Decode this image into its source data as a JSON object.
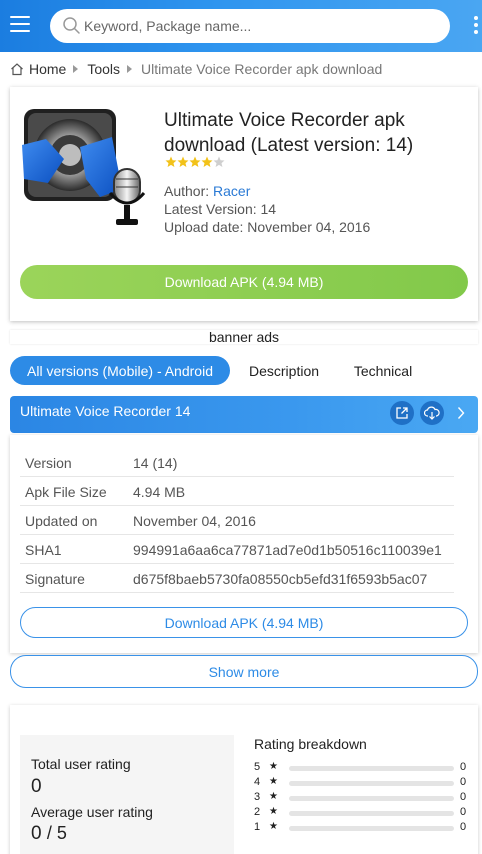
{
  "header": {
    "search_placeholder": "Keyword, Package name...",
    "icons": {
      "menu": "hamburger-menu-icon",
      "search": "search-icon",
      "more": "vertical-dots-icon"
    }
  },
  "breadcrumb": {
    "items": [
      "Home",
      "Tools",
      "Ultimate Voice Recorder apk download"
    ]
  },
  "app": {
    "title": "Ultimate Voice Recorder apk download (Latest version: 14)",
    "rating_stars": 4,
    "rating_max": 5,
    "author_label": "Author: ",
    "author_name": "Racer",
    "latest_version_line": "Latest Version: 14",
    "upload_date_line": "Upload date: November 04, 2016",
    "download_button": "Download APK (4.94 MB)"
  },
  "banner": {
    "text": "banner ads"
  },
  "tabs": [
    {
      "label": "All versions (Mobile) - Android",
      "active": true
    },
    {
      "label": "Description",
      "active": false
    },
    {
      "label": "Technical",
      "active": false
    }
  ],
  "version_block": {
    "title": "Ultimate Voice Recorder 14",
    "icons": {
      "external": "external-link-icon",
      "download": "cloud-download-icon",
      "chevron": "chevron-right-icon"
    },
    "details": [
      {
        "label": "Version",
        "value": "14 (14)"
      },
      {
        "label": "Apk File Size",
        "value": "4.94 MB"
      },
      {
        "label": "Updated on",
        "value": "November 04, 2016"
      },
      {
        "label": "SHA1",
        "value": "994991a6aa6ca77871ad7e0d1b50516c110039e1"
      },
      {
        "label": "Signature",
        "value": "d675f8baeb5730fa08550cb5efd31f6593b5ac07"
      }
    ],
    "download_button": "Download APK (4.94 MB)"
  },
  "show_more": "Show more",
  "rating": {
    "total_label": "Total user rating",
    "total_value": "0",
    "average_label": "Average user rating",
    "average_value": "0",
    "average_max": "/ 5",
    "breakdown_title": "Rating breakdown",
    "breakdown": [
      {
        "stars": "5",
        "count": "0",
        "fraction": 0
      },
      {
        "stars": "4",
        "count": "0",
        "fraction": 0
      },
      {
        "stars": "3",
        "count": "0",
        "fraction": 0
      },
      {
        "stars": "2",
        "count": "0",
        "fraction": 0
      },
      {
        "stars": "1",
        "count": "0",
        "fraction": 0
      }
    ]
  },
  "colors": {
    "accent_blue": "#2d8be6",
    "download_green": "#8ccd50",
    "star_gold": "#f2c21a"
  }
}
